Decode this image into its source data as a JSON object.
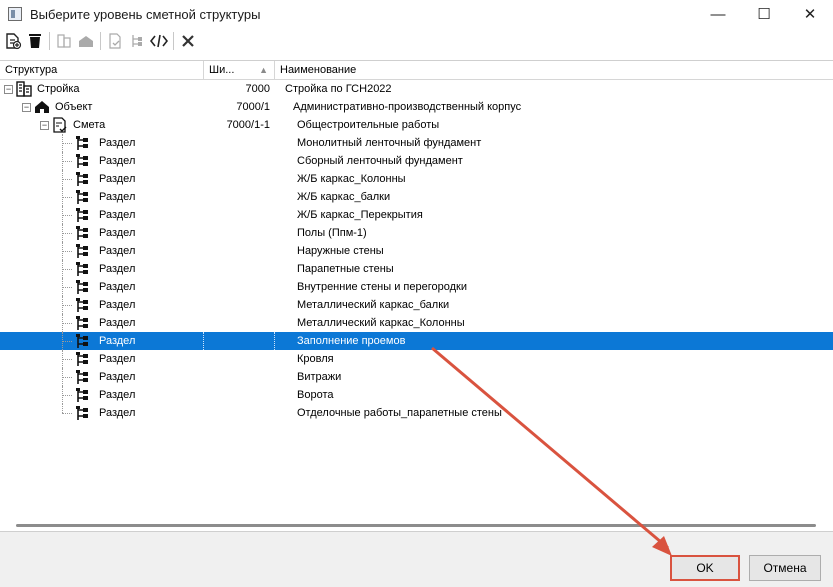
{
  "window": {
    "title": "Выберите уровень сметной структуры",
    "minimize_glyph": "—",
    "maximize_glyph": "☐",
    "close_glyph": "✕"
  },
  "toolbar": {
    "icons": [
      "add-document-icon",
      "delete-icon",
      "building-icon",
      "home-icon",
      "check-document-icon",
      "structure-icon",
      "code-icon",
      "close-x-icon"
    ]
  },
  "columns": {
    "structure": "Структура",
    "code": "Ши...",
    "code_sort": "▲",
    "name": "Наименование"
  },
  "rows": [
    {
      "type": "Стройка",
      "code": "7000",
      "name": "Стройка по ГСН2022"
    },
    {
      "type": "Объект",
      "code": "7000/1",
      "name": "Административно-производственный корпус"
    },
    {
      "type": "Смета",
      "code": "7000/1-1",
      "name": "Общестроительные работы"
    },
    {
      "type": "Раздел",
      "code": "",
      "name": "Монолитный ленточный фундамент"
    },
    {
      "type": "Раздел",
      "code": "",
      "name": "Сборный ленточный фундамент"
    },
    {
      "type": "Раздел",
      "code": "",
      "name": "Ж/Б каркас_Колонны"
    },
    {
      "type": "Раздел",
      "code": "",
      "name": "Ж/Б каркас_балки"
    },
    {
      "type": "Раздел",
      "code": "",
      "name": "Ж/Б каркас_Перекрытия"
    },
    {
      "type": "Раздел",
      "code": "",
      "name": "Полы (Ппм-1)"
    },
    {
      "type": "Раздел",
      "code": "",
      "name": "Наружные стены"
    },
    {
      "type": "Раздел",
      "code": "",
      "name": "Парапетные стены"
    },
    {
      "type": "Раздел",
      "code": "",
      "name": "Внутренние стены и перегородки"
    },
    {
      "type": "Раздел",
      "code": "",
      "name": "Металлический каркас_балки"
    },
    {
      "type": "Раздел",
      "code": "",
      "name": "Металлический каркас_Колонны"
    },
    {
      "type": "Раздел",
      "code": "",
      "name": "Заполнение проемов"
    },
    {
      "type": "Раздел",
      "code": "",
      "name": "Кровля"
    },
    {
      "type": "Раздел",
      "code": "",
      "name": "Витражи"
    },
    {
      "type": "Раздел",
      "code": "",
      "name": "Ворота"
    },
    {
      "type": "Раздел",
      "code": "",
      "name": "Отделочные работы_парапетные стены"
    }
  ],
  "selected_row": 14,
  "buttons": {
    "ok": "OK",
    "cancel": "Отмена"
  },
  "colors": {
    "selection": "#0c78d6",
    "annotation": "#d9533f"
  }
}
